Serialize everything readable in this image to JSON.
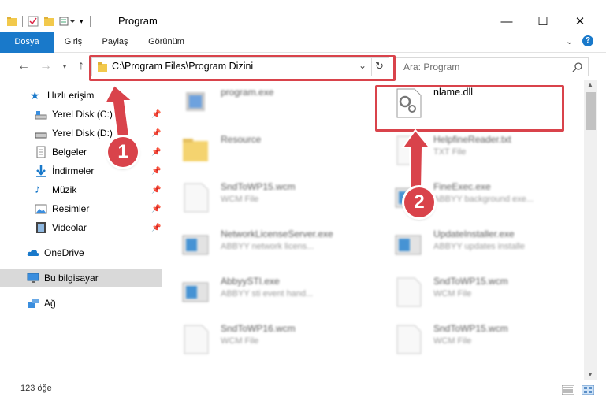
{
  "window": {
    "title": "Program",
    "minimize": "—",
    "maximize": "☐",
    "close": "✕"
  },
  "ribbon": {
    "tabs": [
      "Dosya",
      "Giriş",
      "Paylaş",
      "Görünüm"
    ]
  },
  "address": {
    "path": "C:\\Program Files\\Program Dizini"
  },
  "search": {
    "placeholder": "Ara: Program"
  },
  "sidebar": {
    "quick_access": "Hızlı erişim",
    "items": [
      {
        "label": "Yerel Disk (C:)"
      },
      {
        "label": "Yerel Disk (D:)"
      },
      {
        "label": "Belgeler"
      },
      {
        "label": "İndirmeler"
      },
      {
        "label": "Müzik"
      },
      {
        "label": "Resimler"
      },
      {
        "label": "Videolar"
      }
    ],
    "onedrive": "OneDrive",
    "this_pc": "Bu bilgisayar",
    "network": "Ağ"
  },
  "files": [
    {
      "name": "program.exe",
      "type": ""
    },
    {
      "name": "nlame.dll",
      "type": ""
    },
    {
      "name": "Resource",
      "type": ""
    },
    {
      "name": "HelpfineReader.txt",
      "type": "TXT File"
    },
    {
      "name": "SndToWP15.wcm",
      "type": "WCM File"
    },
    {
      "name": "FineExec.exe",
      "type": "ABBYY background exe..."
    },
    {
      "name": "NetworkLicenseServer.exe",
      "type": "ABBYY network licens..."
    },
    {
      "name": "UpdateInstaller.exe",
      "type": "ABBYY updates installe"
    },
    {
      "name": "AbbyySTI.exe",
      "type": "ABBYY sti event hand..."
    },
    {
      "name": "SndToWP15.wcm",
      "type": "WCM File"
    },
    {
      "name": "SndToWP16.wcm",
      "type": "WCM File"
    },
    {
      "name": "SndToWP15.wcm",
      "type": "WCM File"
    }
  ],
  "status": {
    "count": "123 öğe"
  },
  "annotations": {
    "badge1": "1",
    "badge2": "2"
  },
  "colors": {
    "accent": "#1979ca",
    "highlight": "#d9434b"
  }
}
